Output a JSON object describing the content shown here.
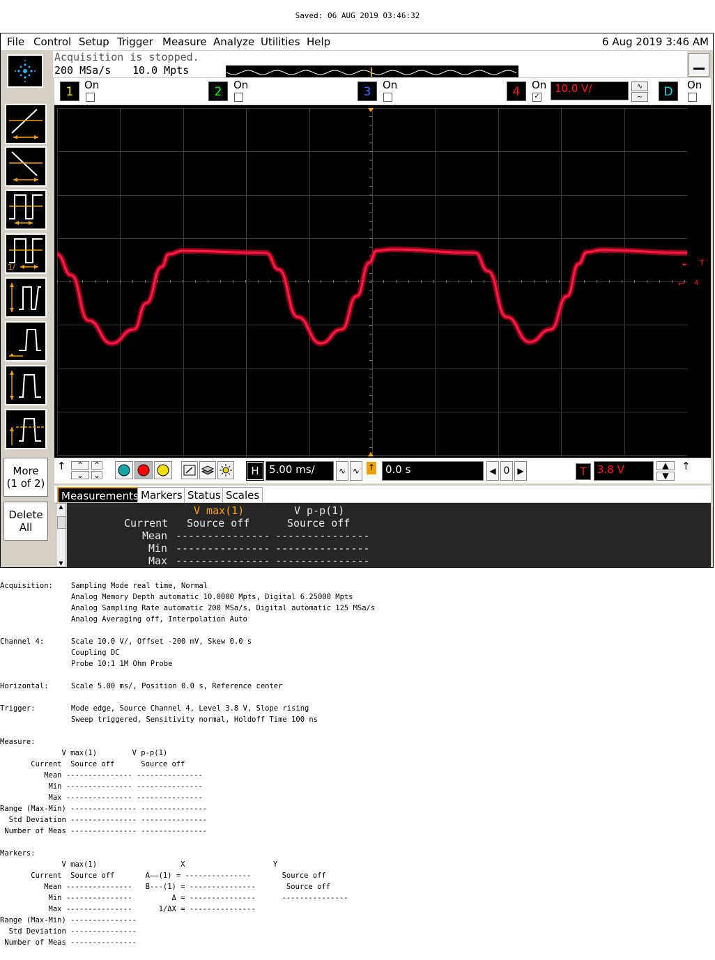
{
  "saved": "Saved: 06 AUG 2019 03:46:32",
  "menu": {
    "items": [
      "File",
      "Control",
      "Setup",
      "Trigger",
      "Measure",
      "Analyze",
      "Utilities",
      "Help"
    ],
    "datetime": "6 Aug 2019  3:46 AM"
  },
  "acquisition": {
    "status": "Acquisition is stopped.",
    "sample_rate": "200 MSa/s",
    "memory_depth": "10.0 Mpts"
  },
  "channels": [
    {
      "label": "1",
      "state": "On",
      "color": "#ffff00",
      "checked": false
    },
    {
      "label": "2",
      "state": "On",
      "color": "#00ff00",
      "checked": false
    },
    {
      "label": "3",
      "state": "On",
      "color": "#3b6bff",
      "checked": false
    },
    {
      "label": "4",
      "state": "On",
      "color": "#ff1a1a",
      "checked": true,
      "scale": "10.0 V/"
    },
    {
      "label": "D",
      "state": "On",
      "color": "#00e0e0",
      "checked": false
    }
  ],
  "left_toolbar": {
    "more_label": "More",
    "more_page": "(1 of 2)",
    "delete_label": "Delete",
    "delete_label2": "All"
  },
  "screen": {
    "trigger_marker": "T",
    "channel_marker": "4",
    "trace_color": "#ff1a4a"
  },
  "control_bar": {
    "horizontal_label": "H",
    "timebase": "5.00 ms/",
    "position": "0.0 s",
    "ref_value": "0",
    "trigger_label": "T",
    "trigger_level": "3.8 V"
  },
  "tabs": [
    "Measurements",
    "Markers",
    "Status",
    "Scales"
  ],
  "measurements": {
    "col1": "V max(1)",
    "col2": "V p-p(1)",
    "row_current": "Current",
    "current1": "Source off",
    "current2": "Source off",
    "row_mean": "Mean",
    "row_min": "Min",
    "row_max": "Max",
    "dash": "---------------"
  },
  "report": {
    "acq_label": "Acquisition:",
    "acq_lines": [
      "Sampling Mode real time, Normal",
      "Analog Memory Depth automatic 10.0000 Mpts, Digital 6.25000 Mpts",
      "Analog Sampling Rate automatic 200 MSa/s, Digital automatic 125 MSa/s",
      "Analog Averaging off, Interpolation Auto"
    ],
    "ch_label": "Channel 4:",
    "ch_lines": [
      "Scale 10.0 V/, Offset -200 mV, Skew 0.0 s",
      "Coupling DC",
      "Probe 10:1 1M Ohm Probe"
    ],
    "hor_label": "Horizontal:",
    "hor_lines": [
      "Scale 5.00 ms/, Position 0.0 s, Reference center"
    ],
    "trig_label": "Trigger:",
    "trig_lines": [
      "Mode edge, Source Channel 4, Level 3.8 V, Slope rising",
      "Sweep triggered, Sensitivity normal, Holdoff Time 100 ns"
    ],
    "measure_label": "Measure:",
    "measure_lines": [
      "              V max(1)        V p-p(1)",
      "       Current  Source off      Source off",
      "          Mean --------------- ---------------",
      "           Min --------------- ---------------",
      "           Max --------------- ---------------",
      "Range (Max-Min) --------------- ---------------",
      "  Std Deviation --------------- ---------------",
      " Number of Meas --------------- ---------------"
    ],
    "markers_label": "Markers:",
    "markers_lines": [
      "              V max(1)                   X                    Y",
      "       Current  Source off       A——(1) = ---------------       Source off",
      "          Mean ---------------   B---(1) = ---------------       Source off",
      "           Min ---------------         Δ = ---------------      ---------------",
      "           Max ---------------      1/ΔX = ---------------",
      "Range (Max-Min) ---------------",
      "  Std Deviation ---------------",
      " Number of Meas ---------------"
    ]
  }
}
